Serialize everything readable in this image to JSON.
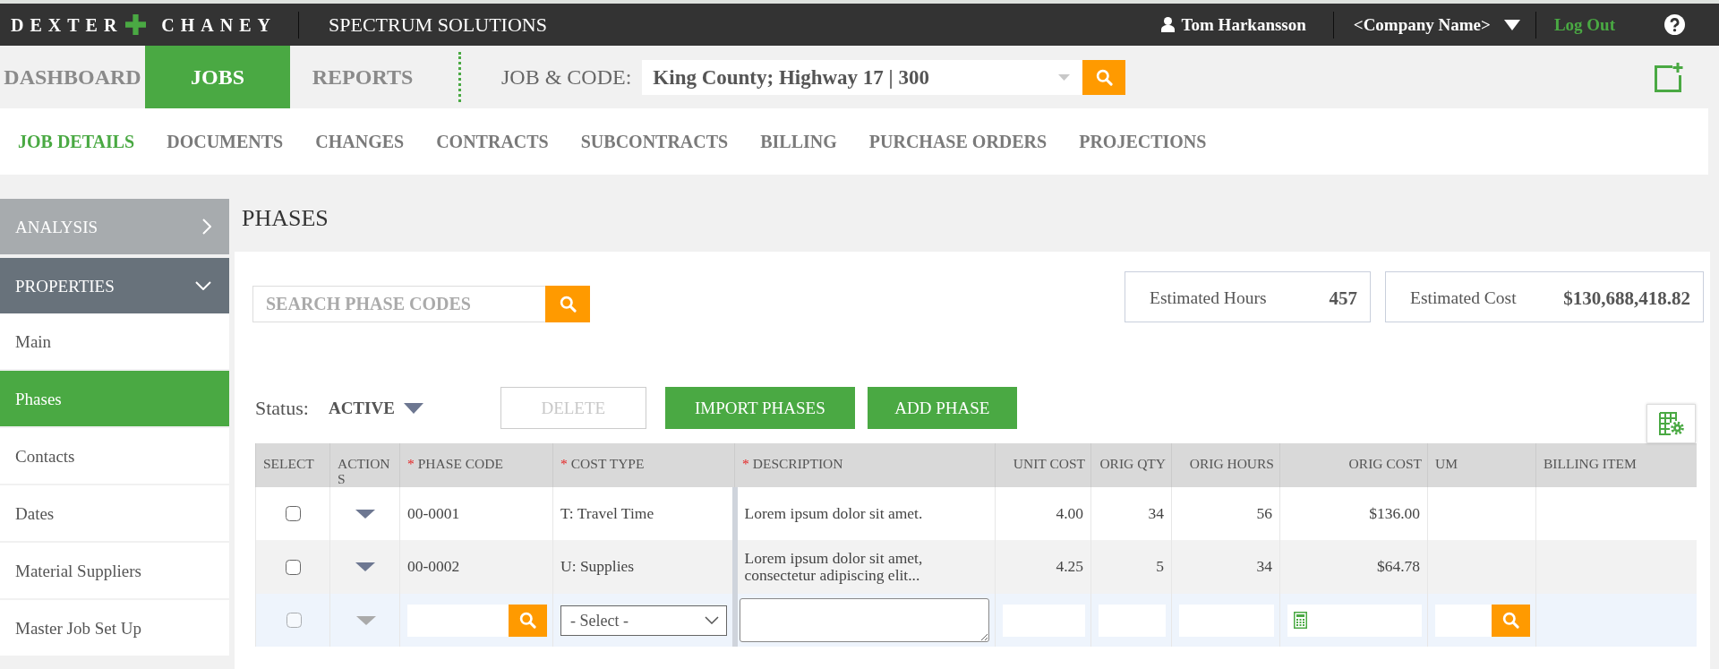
{
  "header": {
    "logo_left": "DEXTER",
    "logo_right": "CHANEY",
    "product": "SPECTRUM SOLUTIONS",
    "user": "Tom Harkansson",
    "company": "<Company Name>",
    "logout": "Log Out"
  },
  "main_nav": [
    {
      "label": "DASHBOARD",
      "selected": false
    },
    {
      "label": "JOBS",
      "selected": true
    },
    {
      "label": "REPORTS",
      "selected": false
    }
  ],
  "job_picker": {
    "label": "JOB & CODE:",
    "value": "King County; Highway 17 | 300"
  },
  "sub_nav": [
    {
      "label": "JOB DETAILS",
      "selected": true
    },
    {
      "label": "DOCUMENTS",
      "selected": false
    },
    {
      "label": "CHANGES",
      "selected": false
    },
    {
      "label": "CONTRACTS",
      "selected": false
    },
    {
      "label": "SUBCONTRACTS",
      "selected": false
    },
    {
      "label": "BILLING",
      "selected": false
    },
    {
      "label": "PURCHASE ORDERS",
      "selected": false
    },
    {
      "label": "PROJECTIONS",
      "selected": false
    }
  ],
  "sidebar": {
    "sections": [
      {
        "label": "ANALYSIS",
        "expanded": false
      },
      {
        "label": "PROPERTIES",
        "expanded": true,
        "items": [
          {
            "label": "Main",
            "selected": false
          },
          {
            "label": "Phases",
            "selected": true
          },
          {
            "label": "Contacts",
            "selected": false
          },
          {
            "label": "Dates",
            "selected": false
          },
          {
            "label": "Material Suppliers",
            "selected": false
          },
          {
            "label": "Master Job Set Up",
            "selected": false
          }
        ]
      }
    ]
  },
  "page_title": "PHASES",
  "search": {
    "placeholder": "SEARCH PHASE CODES"
  },
  "stats": [
    {
      "label": "Estimated Hours",
      "value": "457"
    },
    {
      "label": "Estimated Cost",
      "value": "$130,688,418.82"
    }
  ],
  "status_filter": {
    "label": "Status:",
    "value": "ACTIVE"
  },
  "actions": [
    {
      "label": "DELETE",
      "disabled": true
    },
    {
      "label": "IMPORT PHASES",
      "disabled": false
    },
    {
      "label": "ADD PHASE",
      "disabled": false
    }
  ],
  "table": {
    "columns": [
      {
        "label": "SELECT",
        "kind": "checkbox"
      },
      {
        "label": "ACTIONS",
        "kind": "action"
      },
      {
        "label": "PHASE CODE",
        "kind": "text",
        "required_mark": "*"
      },
      {
        "label": "COST TYPE",
        "kind": "text",
        "required_mark": "*"
      },
      {
        "label": "DESCRIPTION",
        "kind": "text",
        "required_mark": "*"
      },
      {
        "label": "UNIT COST",
        "kind": "number"
      },
      {
        "label": "ORIG QTY",
        "kind": "number"
      },
      {
        "label": "ORIG HOURS",
        "kind": "number"
      },
      {
        "label": "ORIG COST",
        "kind": "number"
      },
      {
        "label": "UM",
        "kind": "text"
      },
      {
        "label": "BILLING ITEM",
        "kind": "text"
      }
    ],
    "rows": [
      {
        "checked": false,
        "cells": [
          "",
          "",
          "00-0001",
          "T: Travel Time",
          "Lorem ipsum dolor sit amet.",
          "4.00",
          "34",
          "56",
          "$136.00"
        ]
      },
      {
        "checked": false,
        "cells": [
          "",
          "",
          "00-0002",
          "U: Supplies",
          "Lorem ipsum dolor sit amet, consectetur adipiscing elit...",
          "4.25",
          "5",
          "34",
          "$64.78"
        ]
      }
    ],
    "new_row": [
      {
        "kind": "checkbox",
        "disabled": true
      },
      {
        "kind": "action",
        "disabled": true
      },
      {
        "kind": "lookup",
        "disabled": false
      },
      {
        "kind": "select",
        "value": "- Select -",
        "disabled": false
      },
      {
        "kind": "textarea",
        "disabled": false
      },
      {
        "kind": "input",
        "disabled": false
      },
      {
        "kind": "input",
        "disabled": false
      },
      {
        "kind": "input",
        "disabled": false
      },
      {
        "kind": "calculator",
        "disabled": false
      },
      {
        "kind": "lookup",
        "disabled": false
      }
    ]
  }
}
